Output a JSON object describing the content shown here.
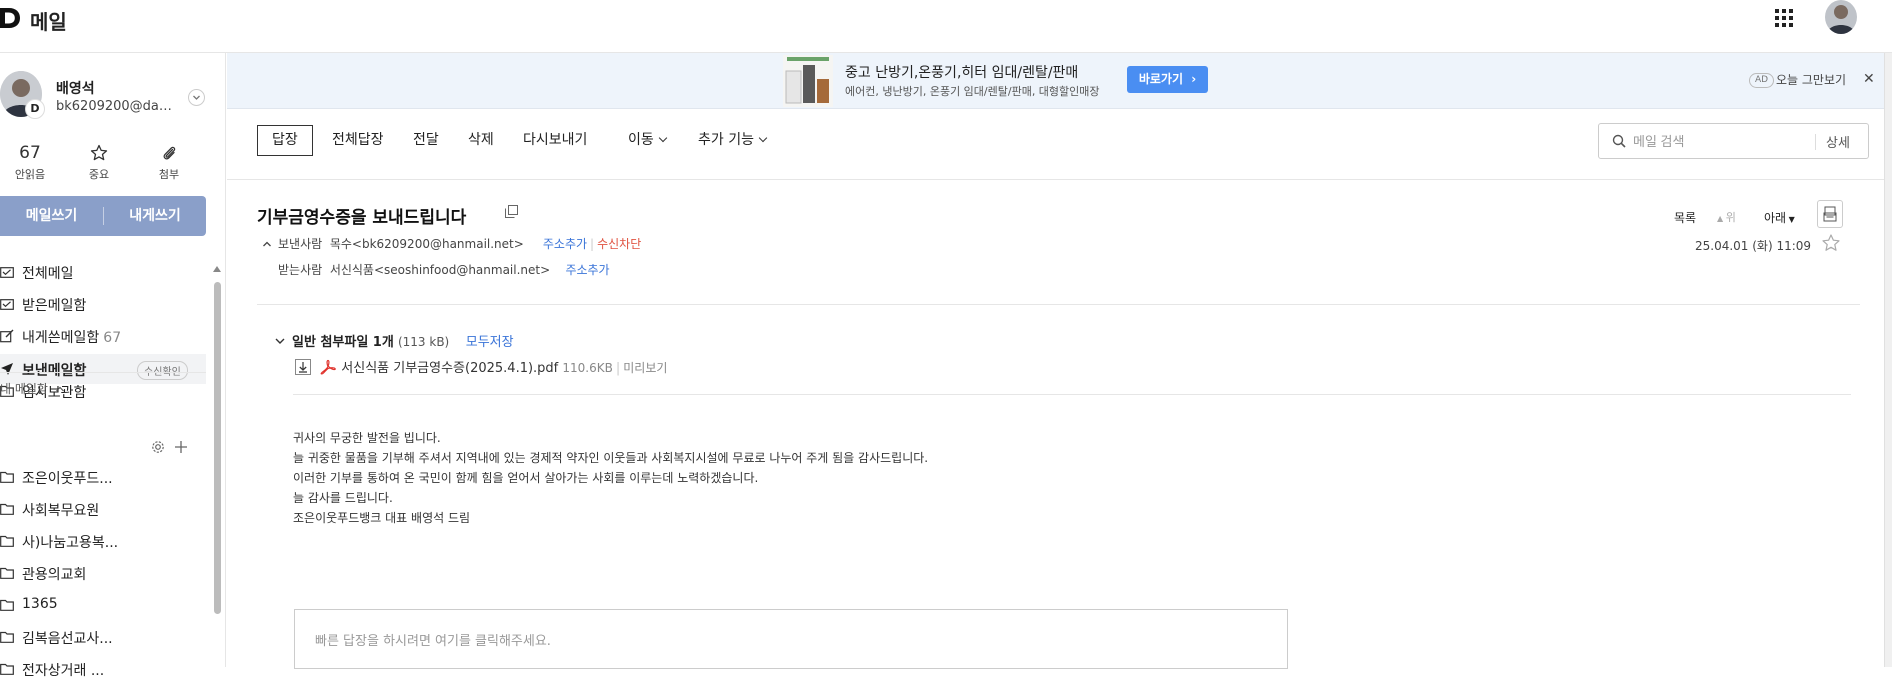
{
  "app": {
    "title": "메일"
  },
  "user": {
    "name": "배영석",
    "email": "bk6209200@dau..."
  },
  "stats": [
    {
      "value": "67",
      "label": "안읽음"
    },
    {
      "label": "중요"
    },
    {
      "label": "첨부"
    }
  ],
  "compose": {
    "write_label": "메일쓰기",
    "self_label": "내게쓰기"
  },
  "folders": [
    {
      "label": "전체메일",
      "icon": "mail-all-icon"
    },
    {
      "label": "받은메일함",
      "icon": "inbox-icon"
    },
    {
      "label": "내게쓴메일함",
      "count": "67",
      "icon": "self-mail-icon"
    },
    {
      "label": "보낸메일함",
      "badge": "수신확인",
      "icon": "sent-icon"
    },
    {
      "label": "임시보관함",
      "icon": "folder-icon"
    }
  ],
  "my_folders": {
    "title": "내 메일함",
    "items": [
      "조은이웃푸드...",
      "사회복무요원",
      "사)나눔고용복...",
      "관용의교회",
      "1365",
      "김복음선교사...",
      "전자상거래 ..."
    ]
  },
  "ad": {
    "title": "중고 난방기,온풍기,히터 임대/렌탈/판매",
    "subtitle": "에어컨, 냉난방기, 온풍기 임대/렌탈/판매, 대형할인매장",
    "button": "바로가기",
    "badge": "AD",
    "dismiss": "오늘 그만보기"
  },
  "toolbar": {
    "reply": "답장",
    "reply_all": "전체답장",
    "forward": "전달",
    "delete": "삭제",
    "resend": "다시보내기",
    "move": "이동",
    "more": "추가 기능"
  },
  "search": {
    "placeholder": "메일 검색",
    "detail": "상세"
  },
  "mail": {
    "subject": "기부금영수증을 보내드립니다",
    "sender_label": "보낸사람",
    "sender": "목수<bk6209200@hanmail.net>",
    "add_address": "주소추가",
    "block": "수신차단",
    "recipient_label": "받는사람",
    "recipient": "서신식품<seoshinfood@hanmail.net>",
    "date": "25.04.01 (화) 11:09",
    "nav": {
      "list": "목록",
      "prev": "위",
      "next": "아래"
    }
  },
  "attachment": {
    "title": "일반 첨부파일 1개",
    "size": "(113 kB)",
    "save_all": "모두저장",
    "file_name": "서신식품 기부금영수증(2025.4.1).pdf",
    "file_size": "110.6KB",
    "preview": "미리보기"
  },
  "body": [
    "귀사의 무궁한 발전을 빕니다.",
    "늘 귀중한 물품을 기부해 주셔서 지역내에 있는 경제적 약자인 이웃들과 사회복지시설에 무료로 나누어 주게 됨을 감사드립니다.",
    "이러한 기부를 통하여 온 국민이 함께 힘을 얻어서 살아가는 사회를 이루는데 노력하겠습니다.",
    "늘 감사를 드립니다.",
    "조은이웃푸드뱅크 대표 배영석 드림"
  ],
  "quick_reply": {
    "placeholder": "빠른 답장을 하시려면 여기를 클릭해주세요."
  },
  "colors": {
    "accent": "#4a8ef2",
    "compose_bg": "#8a9fc9",
    "link": "#3a74d8",
    "block": "#e05240",
    "ad_bg": "#eef4fb"
  }
}
